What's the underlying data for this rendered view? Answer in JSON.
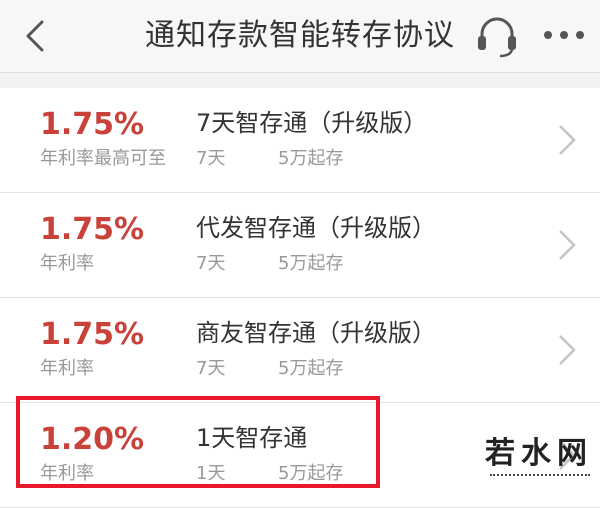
{
  "header": {
    "title": "通知存款智能转存协议",
    "back_icon": "chevron-left-icon",
    "support_icon": "headset-icon",
    "more_icon": "more-dots-icon"
  },
  "products": [
    {
      "rate": "1.75%",
      "rate_label": "年利率最高可至",
      "name": "7天智存通（升级版）",
      "term": "7天",
      "minimum": "5万起存"
    },
    {
      "rate": "1.75%",
      "rate_label": "年利率",
      "name": "代发智存通（升级版）",
      "term": "7天",
      "minimum": "5万起存"
    },
    {
      "rate": "1.75%",
      "rate_label": "年利率",
      "name": "商友智存通（升级版）",
      "term": "7天",
      "minimum": "5万起存"
    },
    {
      "rate": "1.20%",
      "rate_label": "年利率",
      "name": "1天智存通",
      "term": "1天",
      "minimum": "5万起存"
    }
  ],
  "highlight_color": "#e8192c",
  "rate_color": "#c9423a",
  "watermark": {
    "text": "若水网"
  }
}
